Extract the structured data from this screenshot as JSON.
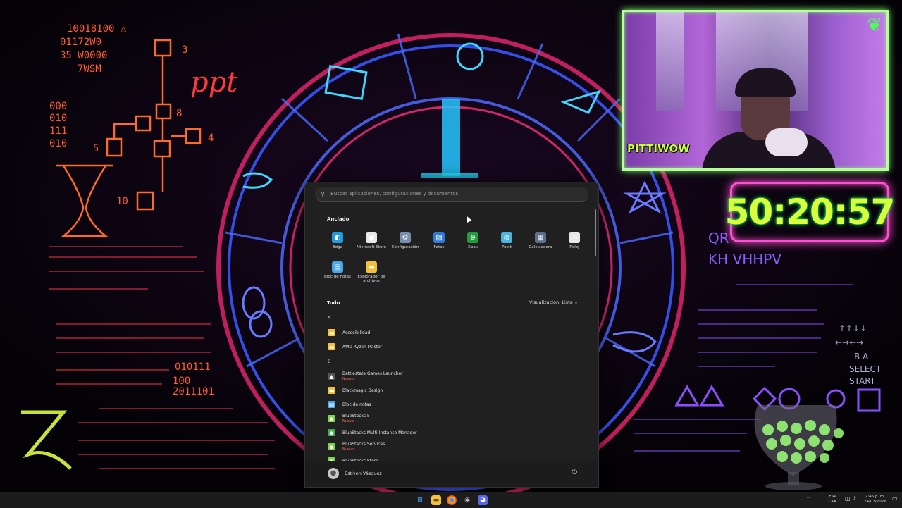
{
  "timer": "50:20:57",
  "webcam": {
    "logo": "PITTIWOW"
  },
  "start_menu": {
    "search_placeholder": "Buscar aplicaciones, configuraciones y documentos",
    "pinned_title": "Anclado",
    "pinned": [
      {
        "label": "Edge",
        "icon": "edge-icon",
        "color": "#1f9be0"
      },
      {
        "label": "Microsoft Store",
        "icon": "store-icon",
        "color": "#e8e8e8"
      },
      {
        "label": "Configuración",
        "icon": "gear-icon",
        "color": "#7a8fb0"
      },
      {
        "label": "Fotos",
        "icon": "photos-icon",
        "color": "#2f7ad8"
      },
      {
        "label": "Xbox",
        "icon": "xbox-icon",
        "color": "#1f9e3a"
      },
      {
        "label": "Paint",
        "icon": "paint-icon",
        "color": "#4ab4e0"
      },
      {
        "label": "Calculadora",
        "icon": "calculator-icon",
        "color": "#5a6f8a"
      },
      {
        "label": "Reloj",
        "icon": "clock-icon",
        "color": "#e8e8e8"
      },
      {
        "label": "Bloc de notas",
        "icon": "notepad-icon",
        "color": "#4aa8e8"
      },
      {
        "label": "Explorador de archivos",
        "icon": "folder-icon",
        "color": "#f3c23a"
      }
    ],
    "all_title": "Todo",
    "view_label": "Visualización: Lista",
    "groups": [
      {
        "letter": "A",
        "apps": [
          {
            "name": "Accesibilidad",
            "icon": "folder-icon",
            "color": "#f3c23a",
            "badge": ""
          },
          {
            "name": "AMD Ryzen Master",
            "icon": "folder-icon",
            "color": "#f3c23a",
            "badge": ""
          }
        ]
      },
      {
        "letter": "B",
        "apps": [
          {
            "name": "Battlestate Games Launcher",
            "icon": "battlestate-icon",
            "color": "#555555",
            "badge": "Nuevo"
          },
          {
            "name": "Blackmagic Design",
            "icon": "folder-icon",
            "color": "#f3c23a",
            "badge": ""
          },
          {
            "name": "Bloc de notas",
            "icon": "notepad-icon",
            "color": "#4aa8e8",
            "badge": ""
          },
          {
            "name": "BlueStacks 5",
            "icon": "bluestacks-icon",
            "color": "#7bd645",
            "badge": "Nuevo"
          },
          {
            "name": "BlueStacks Multi-Instance Manager",
            "icon": "bluestacks-icon",
            "color": "#3cb44b",
            "badge": ""
          },
          {
            "name": "BlueStacks Services",
            "icon": "bluestacks-icon",
            "color": "#7bd645",
            "badge": "Nuevo"
          },
          {
            "name": "BlueStacks Store",
            "icon": "bluestacks-icon",
            "color": "#7bd645",
            "badge": ""
          }
        ]
      }
    ],
    "user_name": "Estiven Vásquez"
  },
  "tray": {
    "lang_top": "ESP",
    "lang_bottom": "LAA",
    "time": "2:45 p. m.",
    "date": "24/03/2026"
  }
}
